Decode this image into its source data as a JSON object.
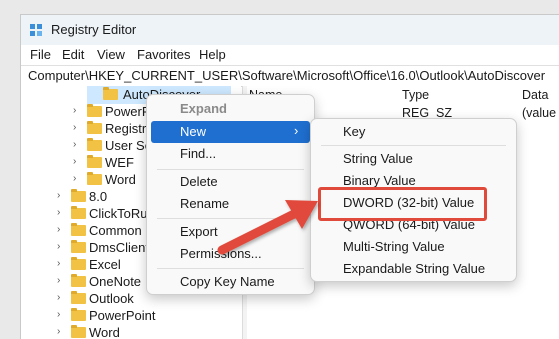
{
  "window": {
    "title": "Registry Editor"
  },
  "menubar": [
    "File",
    "Edit",
    "View",
    "Favorites",
    "Help"
  ],
  "address": "Computer\\HKEY_CURRENT_USER\\Software\\Microsoft\\Office\\16.0\\Outlook\\AutoDiscover",
  "tree": {
    "selected": "AutoDiscover",
    "items": [
      "PowerPo",
      "Registrat",
      "User Set",
      "WEF",
      "Word",
      "8.0",
      "ClickToRun",
      "Common",
      "DmsClient",
      "Excel",
      "OneNote",
      "Outlook",
      "PowerPoint",
      "Word"
    ]
  },
  "values_pane": {
    "columns": [
      "Name",
      "Type",
      "Data"
    ],
    "row": {
      "type": "REG_SZ",
      "data": "(value"
    }
  },
  "context_menu": {
    "items": [
      "Expand",
      "New",
      "Find...",
      "Delete",
      "Rename",
      "Export",
      "Permissions...",
      "Copy Key Name"
    ]
  },
  "submenu": {
    "items": [
      "Key",
      "String Value",
      "Binary Value",
      "DWORD (32-bit) Value",
      "QWORD (64-bit) Value",
      "Multi-String Value",
      "Expandable String Value"
    ]
  },
  "colors": {
    "highlight": "#1f6fd0",
    "arrow": "#e04a3a",
    "selection": "#cde8ff",
    "folder": "#f2c244"
  }
}
